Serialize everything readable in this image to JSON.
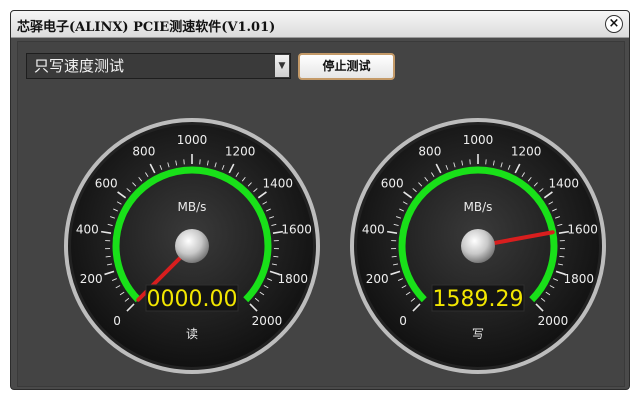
{
  "window": {
    "title": "芯驿电子(ALINX) PCIE测速软件(V1.01)"
  },
  "toolbar": {
    "mode_select": {
      "value": "只写速度测试"
    },
    "stop_button_label": "停止测试"
  },
  "gauges": [
    {
      "id": "read",
      "label": "读",
      "unit": "MB/s",
      "display": "0000.00",
      "value": 0,
      "max": 2000,
      "ticks": [
        "0",
        "200",
        "400",
        "600",
        "800",
        "1000",
        "1200",
        "1400",
        "1600",
        "1800",
        "2000"
      ]
    },
    {
      "id": "write",
      "label": "写",
      "unit": "MB/s",
      "display": "1589.29",
      "value": 1589.29,
      "max": 2000,
      "ticks": [
        "0",
        "200",
        "400",
        "600",
        "800",
        "1000",
        "1200",
        "1400",
        "1600",
        "1800",
        "2000"
      ]
    }
  ],
  "icons": {
    "close": "close-icon",
    "dropdown": "chevron-down-icon"
  },
  "colors": {
    "arc": "#19e019",
    "needle": "#d81e1e",
    "digits": "#f2e600"
  }
}
